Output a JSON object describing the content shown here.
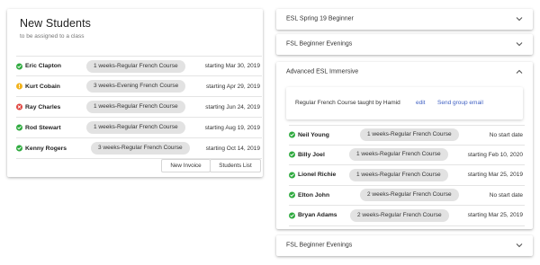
{
  "new_students": {
    "title": "New Students",
    "subtitle": "to be assigned to a class",
    "students": [
      {
        "name": "Eric Clapton",
        "status": "ok",
        "course": "1 weeks-Regular French Course",
        "start": "starting Mar 30, 2019"
      },
      {
        "name": "Kurt Cobain",
        "status": "warning",
        "course": "3 weeks-Evening French Course",
        "start": "starting Apr 29, 2019"
      },
      {
        "name": "Ray Charles",
        "status": "error",
        "course": "1 weeks-Regular French Course",
        "start": "starting Jun 24, 2019"
      },
      {
        "name": "Rod Stewart",
        "status": "ok",
        "course": "1 weeks-Regular French Course",
        "start": "starting Aug 19, 2019"
      },
      {
        "name": "Kenny Rogers",
        "status": "ok",
        "course": "3 weeks-Regular French Course",
        "start": "starting Oct 14, 2019"
      }
    ],
    "new_invoice_label": "New Invoice",
    "students_list_label": "Students List"
  },
  "panels": {
    "p1_title": "ESL Spring 19 Beginner",
    "p2_title": "FSL Beginner Evenings",
    "p3_title": "Advanced ESL Immersive",
    "p4_title": "FSL Beginner Evenings"
  },
  "group": {
    "info_text": "Regular French Course taught by Hamid",
    "edit_label": "edit",
    "email_label": "Send group email",
    "students": [
      {
        "name": "Neil Young",
        "status": "ok",
        "course": "1 weeks-Regular French Course",
        "start": "No start date"
      },
      {
        "name": "Billy Joel",
        "status": "ok",
        "course": "1 weeks-Regular French Course",
        "start": "starting Feb 10, 2020"
      },
      {
        "name": "Lionel Richie",
        "status": "ok",
        "course": "1 weeks-Regular French Course",
        "start": "starting Mar 25, 2019"
      },
      {
        "name": "Elton John",
        "status": "ok",
        "course": "2 weeks-Regular French Course",
        "start": "No start date"
      },
      {
        "name": "Bryan Adams",
        "status": "ok",
        "course": "2 weeks-Regular French Course",
        "start": "starting Mar 25, 2019"
      }
    ]
  },
  "colors": {
    "ok": "#2eaa3e",
    "warning": "#f2b21b",
    "error": "#e0413a",
    "link": "#3d5ec2"
  },
  "icons": {
    "ok": "check-circle-icon",
    "warning": "warning-circle-icon",
    "error": "error-circle-icon",
    "expand": "chevron-down-icon",
    "collapse": "chevron-up-icon"
  }
}
